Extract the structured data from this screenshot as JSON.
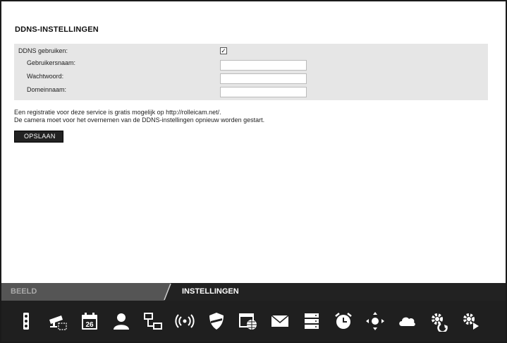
{
  "section_title": "DDNS-INSTELLINGEN",
  "form": {
    "use_ddns_label": "DDNS gebruiken:",
    "use_ddns_checked": true,
    "checkbox_mark": "✓",
    "username_label": "Gebruikersnaam:",
    "username_value": "",
    "password_label": "Wachtwoord:",
    "password_value": "",
    "domain_label": "Domeinnaam:",
    "domain_value": ""
  },
  "info": {
    "line1": "Een registratie voor deze service is gratis mogelijk op http://rolleicam.net/.",
    "line2": "De camera moet voor het overnemen van de DDNS-instellingen opnieuw worden gestart."
  },
  "save_button": "OPSLAAN",
  "tabs": {
    "beeld": "BEELD",
    "instellingen": "INSTELLINGEN",
    "active": "INSTELLINGEN"
  },
  "icons": {
    "calendar_day": "26",
    "items": [
      "traffic-light-icon",
      "camera-network-icon",
      "calendar-icon",
      "user-icon",
      "network-icon",
      "wireless-icon",
      "shield-icon",
      "web-icon",
      "mail-icon",
      "storage-icon",
      "alarm-clock-icon",
      "ptz-control-icon",
      "cloud-icon",
      "maintenance-icon",
      "advanced-settings-icon"
    ]
  },
  "colors": {
    "tab_active_bg": "#222222",
    "tab_inactive_bg": "#555555",
    "form_bg": "#e6e6e6",
    "icon_fill": "#ffffff"
  }
}
